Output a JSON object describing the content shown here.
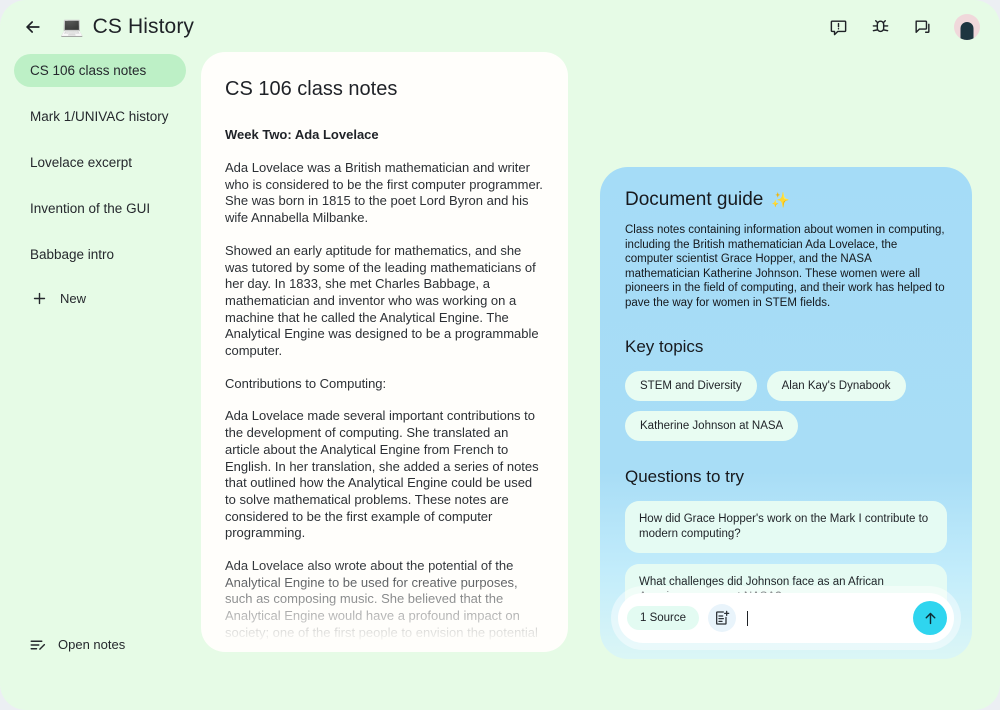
{
  "header": {
    "back_icon": "back-arrow-icon",
    "doc_emoji": "💻",
    "title": "CS History",
    "icons": [
      {
        "name": "feedback-icon",
        "label": "Send feedback"
      },
      {
        "name": "bug-report-icon",
        "label": "Report a bug"
      },
      {
        "name": "chat-icon",
        "label": "Chat"
      }
    ],
    "avatar_label": "Account"
  },
  "sidebar": {
    "items": [
      {
        "label": "CS 106 class notes",
        "active": true
      },
      {
        "label": "Mark 1/UNIVAC history",
        "active": false
      },
      {
        "label": "Lovelace excerpt",
        "active": false
      },
      {
        "label": "Invention of the GUI",
        "active": false
      },
      {
        "label": "Babbage intro",
        "active": false
      }
    ],
    "new_label": "New",
    "new_icon": "plus-icon",
    "open_notes_label": "Open notes",
    "open_notes_icon": "edit-note-icon"
  },
  "document": {
    "title": "CS 106 class notes",
    "subhead": "Week Two: Ada Lovelace",
    "paragraphs": [
      "Ada Lovelace was a British mathematician and writer who is considered to be the first computer programmer. She was born in 1815 to the poet Lord Byron and his wife Annabella Milbanke.",
      "Showed an early aptitude for mathematics, and she was tutored by some of the leading mathematicians of her day. In 1833, she met Charles Babbage, a mathematician and inventor who was working on a machine that he called the Analytical Engine. The Analytical Engine was designed to be a programmable computer.",
      "Contributions to Computing:",
      "Ada Lovelace made several important contributions to the development of computing. She translated an article about the Analytical Engine from French to English. In her translation, she added a series of notes that outlined how the Analytical Engine could be used to solve mathematical problems. These notes are considered to be the first example of computer programming.",
      "Ada Lovelace also wrote about the potential of the Analytical Engine to be used for creative purposes, such as composing music. She believed that the Analytical Engine would have a profound impact on society; one of the first people to envision the potential of computers to be used for more than just calculation."
    ]
  },
  "guide": {
    "title": "Document guide",
    "title_emoji": "✨",
    "description": "Class notes containing information about women in computing, including the British mathematician Ada Lovelace, the computer scientist Grace Hopper, and the NASA mathematician Katherine Johnson. These women were all pioneers in the field of computing, and their work has helped to pave the way for women in STEM fields.",
    "key_topics_title": "Key topics",
    "key_topics": [
      "STEM and Diversity",
      "Alan Kay's Dynabook",
      "Katherine Johnson at NASA"
    ],
    "questions_title": "Questions to try",
    "questions": [
      "How did Grace Hopper's work on the Mark I contribute to modern computing?",
      "What challenges did Johnson face as an African American woman at NASA?"
    ]
  },
  "input_bar": {
    "source_chip": "1 Source",
    "note_icon": "add-note-icon",
    "value": "",
    "placeholder": "",
    "send_icon": "send-arrow-up-icon"
  },
  "colors": {
    "page_background": "#e6fbe6",
    "sidebar_active": "#bdf0c6",
    "document_card": "#fffefb",
    "guide_panel": "#a5dcf7",
    "chip": "#e8fcf2",
    "send_button": "#2fd5ef"
  }
}
